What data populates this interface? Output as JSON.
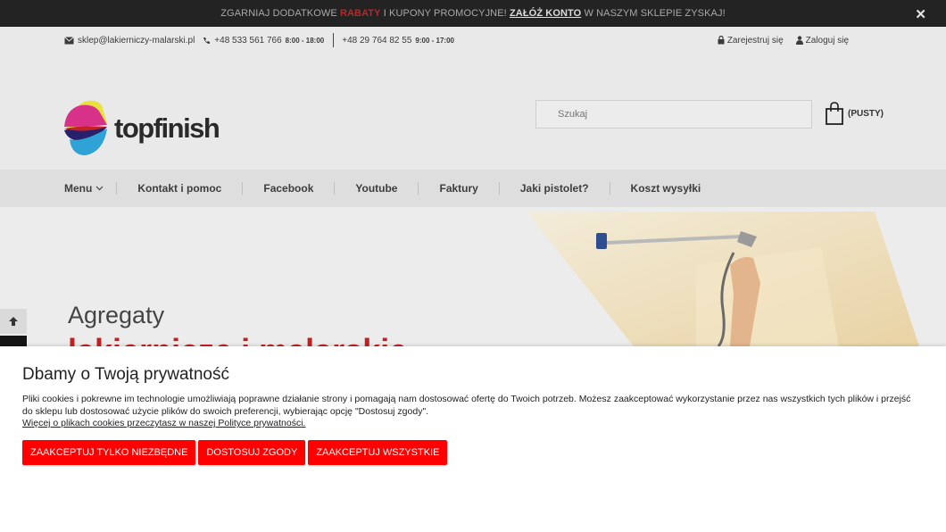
{
  "promo": {
    "text_before": "ZGARNIAJ DODATKOWE",
    "highlight": "RABATY",
    "text_mid": "I KUPONY PROMOCYJNE!",
    "link": "ZAŁÓŻ KONTO",
    "text_after": "W NASZYM SKLEPIE ZYSKAJ!",
    "close": "✕"
  },
  "topbar": {
    "email": "sklep@lakierniczy-malarski.pl",
    "phone1": "+48 533 561 766",
    "hours1": "8:00 - 18:00",
    "phone2": "+48 29 764 82 55",
    "hours2": "9:00 - 17:00",
    "register": "Zarejestruj się",
    "login": "Zaloguj się"
  },
  "logo": {
    "text": "topfinish"
  },
  "search": {
    "placeholder": "Szukaj"
  },
  "cart": {
    "label": "(PUSTY)"
  },
  "nav": {
    "items": [
      "Menu",
      "Kontakt i pomoc",
      "Facebook",
      "Youtube",
      "Faktury",
      "Jaki pistolet?",
      "Koszt wysyłki"
    ]
  },
  "hero": {
    "title": "Agregaty",
    "subtitle": "lakiernicze i malarskie"
  },
  "cookie": {
    "title": "Dbamy o Twoją prywatność",
    "body": "Pliki cookies i pokrewne im technologie umożliwiają poprawne działanie strony i pomagają nam dostosować ofertę do Twoich potrzeb. Możesz zaakceptować wykorzystanie przez nas wszystkich tych plików i przejść do sklepu lub dostosować użycie plików do swoich preferencji, wybierając opcję \"Dostosuj zgody\".",
    "more": "Więcej o plikach cookies przeczytasz w naszej Polityce prywatności.",
    "btn_necessary": "ZAAKCEPTUJ TYLKO NIEZBĘDNE",
    "btn_customize": "DOSTOSUJ ZGODY",
    "btn_all": "ZAAKCEPTUJ WSZYSTKIE"
  },
  "colors": {
    "accent": "#ff0000",
    "promo_bg": "#232323"
  }
}
